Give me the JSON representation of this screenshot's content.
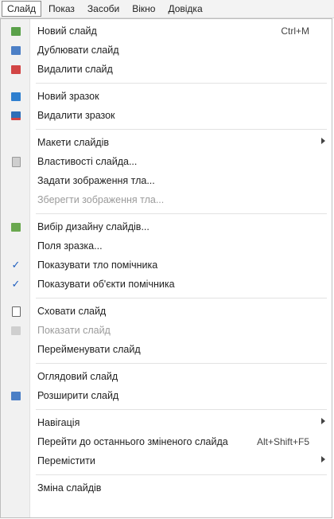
{
  "menubar": [
    "Слайд",
    "Показ",
    "Засоби",
    "Вікно",
    "Довідка"
  ],
  "menu": {
    "new_slide": {
      "label": "Новий слайд",
      "shortcut": "Ctrl+M"
    },
    "duplicate_slide": {
      "label": "Дублювати слайд"
    },
    "delete_slide": {
      "label": "Видалити слайд"
    },
    "new_master": {
      "label": "Новий зразок"
    },
    "delete_master": {
      "label": "Видалити зразок"
    },
    "slide_layouts": {
      "label": "Макети слайдів"
    },
    "slide_properties": {
      "label": "Властивості слайда..."
    },
    "set_background": {
      "label": "Задати зображення тла..."
    },
    "save_background": {
      "label": "Зберегти зображення тла..."
    },
    "slide_design": {
      "label": "Вибір дизайну слайдів..."
    },
    "master_fields": {
      "label": "Поля зразка..."
    },
    "show_master_background": {
      "label": "Показувати тло помічника"
    },
    "show_master_objects": {
      "label": "Показувати об'єкти помічника"
    },
    "hide_slide": {
      "label": "Сховати слайд"
    },
    "show_slide": {
      "label": "Показати слайд"
    },
    "rename_slide": {
      "label": "Перейменувати слайд"
    },
    "overview_slide": {
      "label": "Оглядовий слайд"
    },
    "expand_slide": {
      "label": "Розширити слайд"
    },
    "navigation": {
      "label": "Навігація"
    },
    "go_to_last_edited": {
      "label": "Перейти до останнього зміненого слайда",
      "shortcut": "Alt+Shift+F5"
    },
    "move": {
      "label": "Перемістити"
    },
    "slide_transition": {
      "label": "Зміна слайдів"
    }
  },
  "colors": {
    "check": "#1f5fbf",
    "disabled": "#9b9b9b",
    "gutter": "#f1f1f1"
  },
  "icons": {
    "new_slide": "new-slide-icon",
    "duplicate_slide": "duplicate-slide-icon",
    "delete_slide": "delete-slide-icon",
    "new_master": "new-master-icon",
    "delete_master": "delete-master-icon",
    "slide_properties": "properties-icon",
    "slide_design": "design-icon",
    "hide_slide": "hide-slide-icon",
    "show_slide": "show-slide-icon",
    "expand_slide": "expand-slide-icon"
  }
}
